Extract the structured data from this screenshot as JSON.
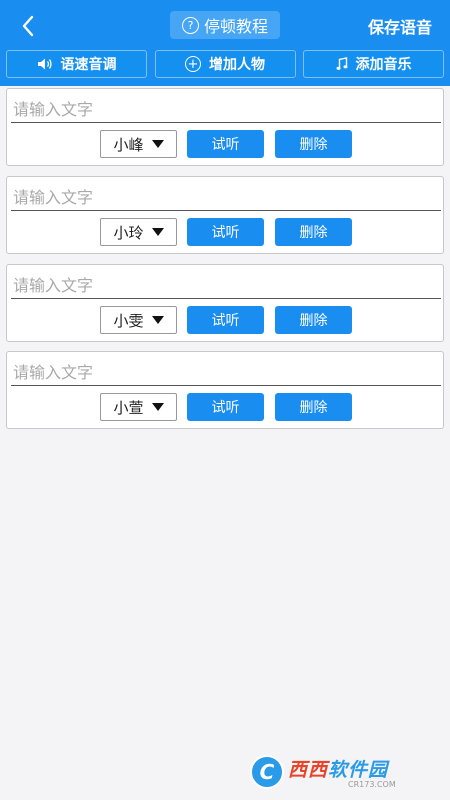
{
  "header": {
    "tutorial_icon": "?",
    "tutorial_label": "停顿教程",
    "save_label": "保存语音",
    "colors": {
      "primary": "#1a8ef0",
      "tutorial_bg": "#46a6f5"
    }
  },
  "toolbar": [
    {
      "icon": "speaker-icon",
      "label": "语速音调"
    },
    {
      "icon": "plus-circle-icon",
      "label": "增加人物"
    },
    {
      "icon": "music-note-icon",
      "label": "添加音乐"
    }
  ],
  "entries": [
    {
      "placeholder": "请输入文字",
      "value": "",
      "voice": "小峰",
      "listen_label": "试听",
      "delete_label": "删除"
    },
    {
      "placeholder": "请输入文字",
      "value": "",
      "voice": "小玲",
      "listen_label": "试听",
      "delete_label": "删除"
    },
    {
      "placeholder": "请输入文字",
      "value": "",
      "voice": "小雯",
      "listen_label": "试听",
      "delete_label": "删除"
    },
    {
      "placeholder": "请输入文字",
      "value": "",
      "voice": "小萱",
      "listen_label": "试听",
      "delete_label": "删除"
    }
  ],
  "watermark": {
    "logo_letter": "C",
    "text_a": "西西",
    "text_b": "软件园",
    "sub": "CR173.COM"
  }
}
